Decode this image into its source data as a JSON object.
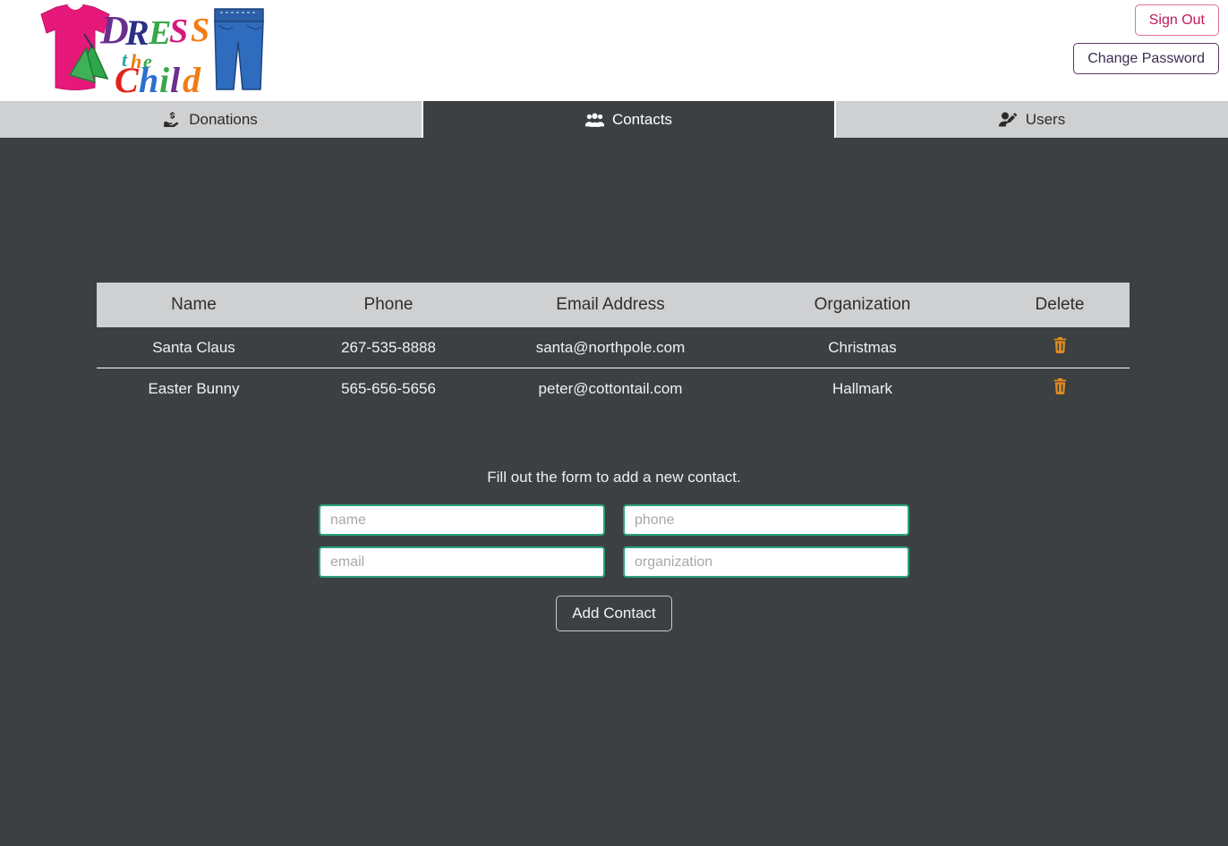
{
  "header": {
    "logo": {
      "alt": "Dress the Child",
      "word1": "DRESS",
      "word_small": "the",
      "word2": "Child"
    },
    "sign_out_label": "Sign Out",
    "change_password_label": "Change Password",
    "sign_out_color": "#c2185b",
    "change_password_color": "#3b2c52"
  },
  "tabs": [
    {
      "label": "Donations",
      "icon": "hand-holding-dollar-icon",
      "active": false
    },
    {
      "label": "Contacts",
      "icon": "users-group-icon",
      "active": true
    },
    {
      "label": "Users",
      "icon": "user-edit-icon",
      "active": false
    }
  ],
  "table": {
    "columns": [
      "Name",
      "Phone",
      "Email Address",
      "Organization",
      "Delete"
    ],
    "delete_icon": "trash-icon",
    "delete_icon_color": "#e08b1e",
    "rows": [
      {
        "name": "Santa Claus",
        "phone": "267-535-8888",
        "email": "santa@northpole.com",
        "organization": "Christmas"
      },
      {
        "name": "Easter Bunny",
        "phone": "565-656-5656",
        "email": "peter@cottontail.com",
        "organization": "Hallmark"
      }
    ]
  },
  "form": {
    "caption": "Fill out the form to add a new contact.",
    "fields": [
      {
        "name": "name",
        "placeholder": "name",
        "value": ""
      },
      {
        "name": "phone",
        "placeholder": "phone",
        "value": ""
      },
      {
        "name": "email",
        "placeholder": "email",
        "value": ""
      },
      {
        "name": "organization",
        "placeholder": "organization",
        "value": ""
      }
    ],
    "submit_label": "Add Contact",
    "field_border_color": "#2aa17d"
  },
  "theme": {
    "page_background": "#3c4043",
    "header_background": "#ffffff",
    "tab_inactive_background": "#cfd0d2",
    "table_header_background": "#cfd0d2"
  }
}
